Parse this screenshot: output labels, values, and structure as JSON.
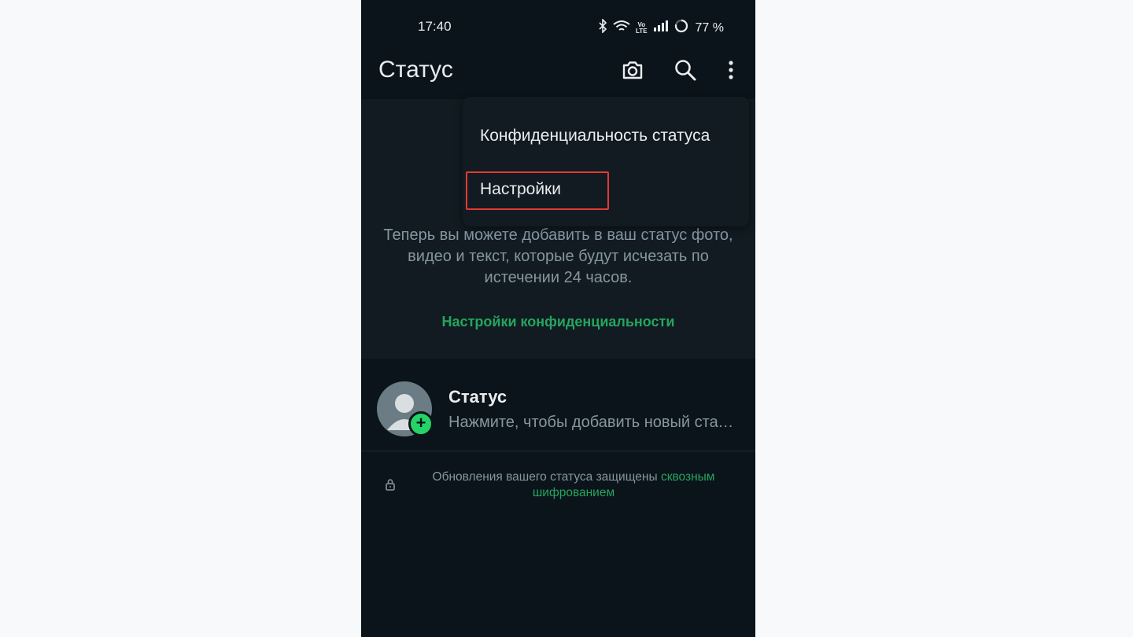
{
  "status_bar": {
    "time": "17:40",
    "volte_line1": "Vo",
    "volte_line2": "LTE",
    "battery": "77 %",
    "icons": [
      "bluetooth-icon",
      "wifi-icon",
      "volte-icon",
      "signal-icon",
      "battery-icon"
    ]
  },
  "appbar": {
    "title": "Статус",
    "icons": [
      "camera-icon",
      "search-icon",
      "more-vert-icon"
    ]
  },
  "promo": {
    "text": "Теперь вы можете добавить в ваш статус фото, видео и текст, которые будут исчезать по истечении 24 часов.",
    "link": "Настройки конфиденциальности"
  },
  "my_status": {
    "name": "Статус",
    "subtitle": "Нажмите, чтобы добавить новый статус",
    "badge": "+"
  },
  "e2e": {
    "text": "Обновления вашего статуса защищены ",
    "link": "сквозным шифрованием"
  },
  "menu": {
    "items": [
      {
        "label": "Конфиденциальность статуса"
      },
      {
        "label": "Настройки",
        "highlighted": true
      }
    ]
  },
  "colors": {
    "background": "#0b141a",
    "surface": "#111b21",
    "accent": "#25d366",
    "link": "#25a55f",
    "highlight": "#e53935"
  }
}
